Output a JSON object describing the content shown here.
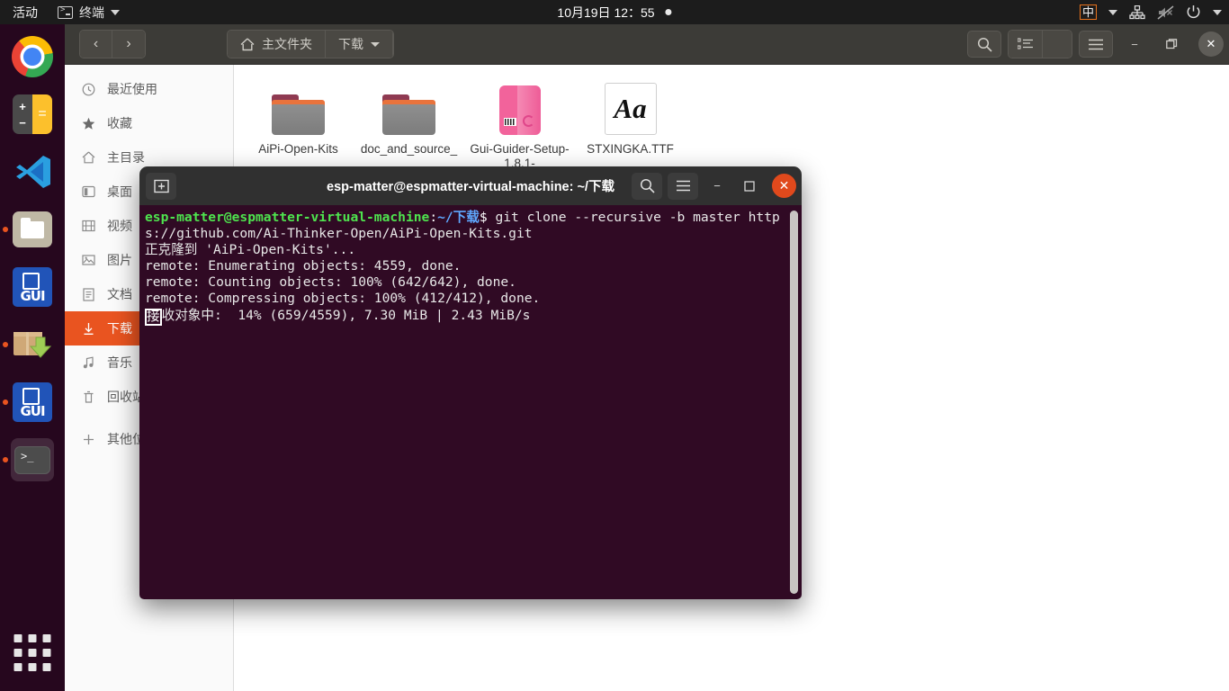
{
  "topbar": {
    "activities": "活动",
    "app_name": "终端",
    "app_icon": "terminal-icon",
    "clock": "10月19日  12：55",
    "ime": "中",
    "icons": [
      "network-icon",
      "volume-muted-icon",
      "power-icon",
      "chevron-down-icon"
    ]
  },
  "dock": {
    "items": [
      {
        "name": "google-chrome",
        "running": false
      },
      {
        "name": "calculator",
        "running": false,
        "plus": "+",
        "minus": "−",
        "equals": "="
      },
      {
        "name": "visual-studio-code",
        "running": false
      },
      {
        "name": "files-nautilus",
        "running": true
      },
      {
        "name": "gui-guider",
        "running": false,
        "label": "GUI"
      },
      {
        "name": "software-installer",
        "running": true
      },
      {
        "name": "gui-guider-2",
        "running": true,
        "label": "GUI"
      },
      {
        "name": "terminal",
        "running": true,
        "glyph": ">_"
      }
    ],
    "show_applications": "show-applications-grid"
  },
  "file_manager": {
    "nav": {
      "back": "‹",
      "forward": "›"
    },
    "breadcrumb": [
      {
        "label": "主文件夹",
        "icon": "home-icon",
        "current": false
      },
      {
        "label": "下载",
        "icon": "chevron-down-icon",
        "current": true
      }
    ],
    "toolbar": {
      "search": "search-icon",
      "view_list": "list-view-icon",
      "view_dropdown": "chevron-down-icon",
      "menu": "hamburger-menu-icon",
      "minimize": "−",
      "maximize": "❐",
      "close": "✕"
    },
    "sidebar": [
      {
        "label": "最近使用",
        "icon": "clock-icon",
        "selected": false
      },
      {
        "label": "收藏",
        "icon": "star-icon",
        "selected": false
      },
      {
        "label": "主目录",
        "icon": "home-icon",
        "selected": false
      },
      {
        "label": "桌面",
        "icon": "desktop-icon",
        "selected": false
      },
      {
        "label": "视频",
        "icon": "video-icon",
        "selected": false
      },
      {
        "label": "图片",
        "icon": "image-icon",
        "selected": false
      },
      {
        "label": "文档",
        "icon": "document-icon",
        "selected": false
      },
      {
        "label": "下载",
        "icon": "download-icon",
        "selected": true
      },
      {
        "label": "音乐",
        "icon": "music-icon",
        "selected": false
      },
      {
        "label": "回收站",
        "icon": "trash-icon",
        "selected": false
      },
      {
        "label": "其他位置",
        "icon": "plus-icon",
        "selected": false
      }
    ],
    "files": [
      {
        "name": "AiPi-Open-Kits",
        "type": "folder"
      },
      {
        "name": "doc_and_source_",
        "type": "folder"
      },
      {
        "name": "Gui-Guider-Setup-1.8.1-",
        "type": "deb-package"
      },
      {
        "name": "STXINGKA.TTF",
        "type": "font",
        "preview": "Aa"
      }
    ]
  },
  "terminal": {
    "title": "esp-matter@espmatter-virtual-machine: ~/下载",
    "new_tab": "new-tab-icon",
    "search": "search-icon",
    "menu": "hamburger-menu-icon",
    "minimize": "−",
    "maximize": "❐",
    "close": "✕",
    "prompt_user": "esp-matter@espmatter-virtual-machine",
    "prompt_path": "~/下载",
    "prompt_symbol": "$",
    "command": " git clone --recursive -b master https://github.com/Ai-Thinker-Open/AiPi-Open-Kits.git",
    "output_lines": [
      "正克隆到 'AiPi-Open-Kits'...",
      "remote: Enumerating objects: 4559, done.",
      "remote: Counting objects: 100% (642/642), done.",
      "remote: Compressing objects: 100% (412/412), done."
    ],
    "progress_cursor_char": "接",
    "progress_line": "收对象中:  14% (659/4559), 7.30 MiB | 2.43 MiB/s"
  },
  "colors": {
    "ubuntu_orange": "#e95420",
    "terminal_bg": "#300a24",
    "topbar_bg": "#1c1c1c",
    "header_bg": "#3c3b37",
    "terminal_header": "#303030",
    "prompt_green": "#4ee44e",
    "prompt_blue": "#5fa8ff"
  }
}
